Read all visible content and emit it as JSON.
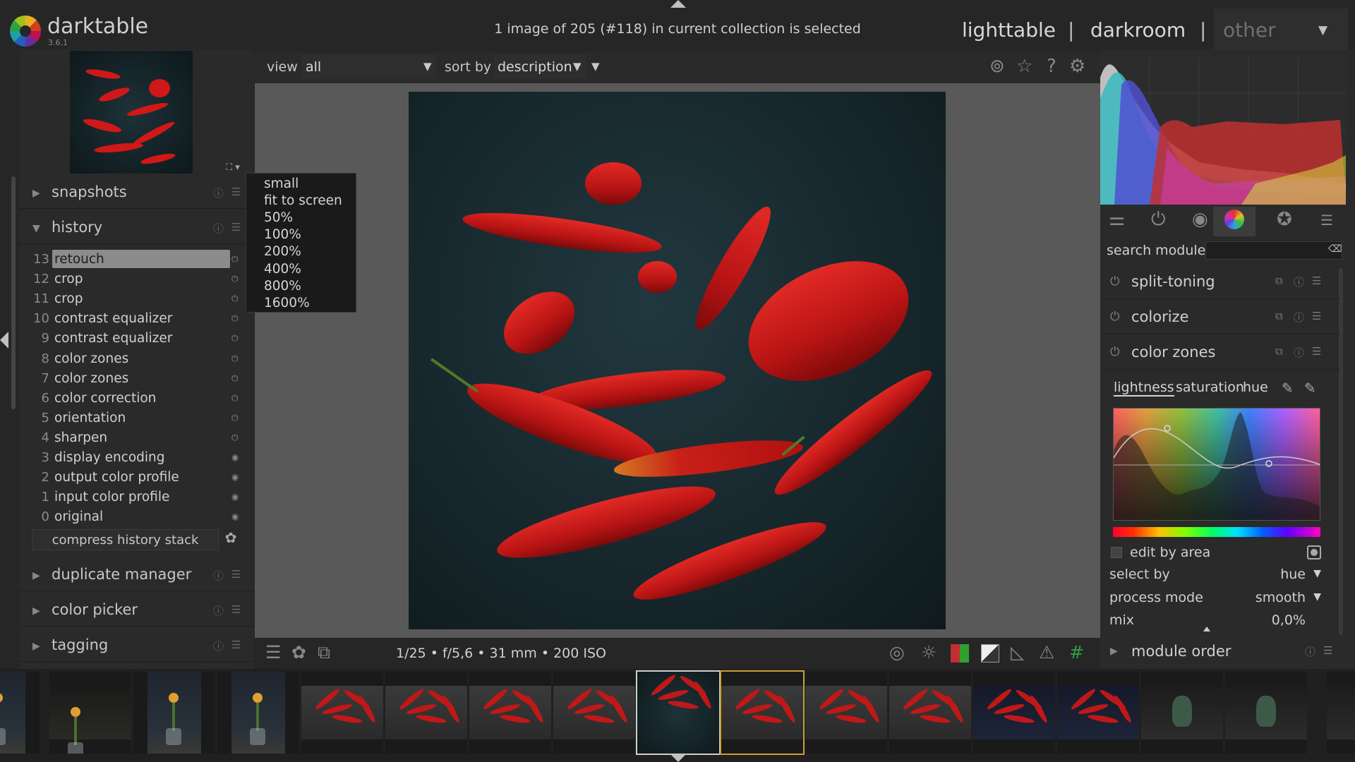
{
  "app": {
    "name": "darktable",
    "version": "3.6.1"
  },
  "header": {
    "selection_info": "1 image of 205 (#118) in current collection is selected",
    "views": {
      "lighttable": "lighttable",
      "darkroom": "darkroom",
      "other": "other"
    },
    "separator": "|"
  },
  "left": {
    "snapshots": "snapshots",
    "history_title": "history",
    "history": [
      {
        "n": "13",
        "name": "retouch"
      },
      {
        "n": "12",
        "name": "crop"
      },
      {
        "n": "11",
        "name": "crop"
      },
      {
        "n": "10",
        "name": "contrast equalizer"
      },
      {
        "n": "9",
        "name": "contrast equalizer"
      },
      {
        "n": "8",
        "name": "color zones"
      },
      {
        "n": "7",
        "name": "color zones"
      },
      {
        "n": "6",
        "name": "color correction"
      },
      {
        "n": "5",
        "name": "orientation"
      },
      {
        "n": "4",
        "name": "sharpen"
      },
      {
        "n": "3",
        "name": "display encoding"
      },
      {
        "n": "2",
        "name": "output color profile"
      },
      {
        "n": "1",
        "name": "input color profile"
      },
      {
        "n": "0",
        "name": "original"
      }
    ],
    "compress": "compress history stack",
    "duplicate_manager": "duplicate manager",
    "color_picker": "color picker",
    "tagging": "tagging"
  },
  "zoom_menu": [
    "small",
    "fit to screen",
    "50%",
    "100%",
    "200%",
    "400%",
    "800%",
    "1600%"
  ],
  "toolbar": {
    "view_label": "view",
    "view_value": "all",
    "sort_label": "sort by",
    "sort_value": "description"
  },
  "exif": "1/25 • f/5,6 • 31 mm • 200 ISO",
  "right": {
    "search_label": "search module",
    "search_value": "",
    "modules": [
      "split-toning",
      "colorize",
      "color zones"
    ],
    "cz_tabs": [
      "lightness",
      "saturation",
      "hue"
    ],
    "edit_by_area": "edit by area",
    "select_by": {
      "label": "select by",
      "value": "hue"
    },
    "process_mode": {
      "label": "process mode",
      "value": "smooth"
    },
    "mix": {
      "label": "mix",
      "value": "0,0%"
    },
    "module_order": "module order"
  },
  "colors": {
    "accent": "#cfcfcf",
    "bg": "#262626",
    "panel": "#2a2a2a",
    "canvas": "#595959",
    "hover_frame": "#c8a030"
  },
  "icons": [
    "expand-icon",
    "grid-icon",
    "star-icon",
    "help-icon",
    "gear-icon",
    "presets-icon",
    "power-icon",
    "base-icon",
    "color-icon",
    "correct-icon",
    "effects-icon",
    "menu-icon"
  ]
}
